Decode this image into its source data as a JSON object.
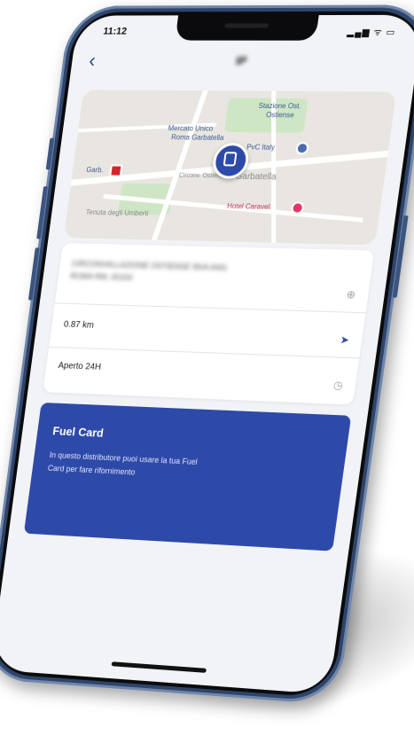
{
  "status_bar": {
    "time": "11:12",
    "icons": "▂▄▆ ᯤ ▭"
  },
  "nav": {
    "back_icon": "‹",
    "title": "IP"
  },
  "map": {
    "labels": {
      "mercato": "Mercato Unico",
      "mercato2": "Roma Garbatella",
      "pvc": "PvC Italy",
      "garbatella": "Garbatella",
      "hotel": "Hotel Caravel",
      "street": "Circonv. Ostiense",
      "top_right": "Stazione Ost.",
      "top_right2": "Ostiense",
      "metro": "Garb.",
      "bottom_left": "Tenuta degli Umberti"
    }
  },
  "details": {
    "address": "CIRCONVALLAZIONE OSTIENSE 95/A ANG. ROMA RM, 00154",
    "distance": "0.87 km",
    "hours": "Aperto 24H"
  },
  "fuel_card": {
    "title": "Fuel Card",
    "description": "In questo distributore puoi usare la tua Fuel Card per fare rifornimento"
  },
  "colors": {
    "accent": "#2e4aa8",
    "frame": "#2f4469",
    "screen_bg": "#f2f3f6"
  }
}
